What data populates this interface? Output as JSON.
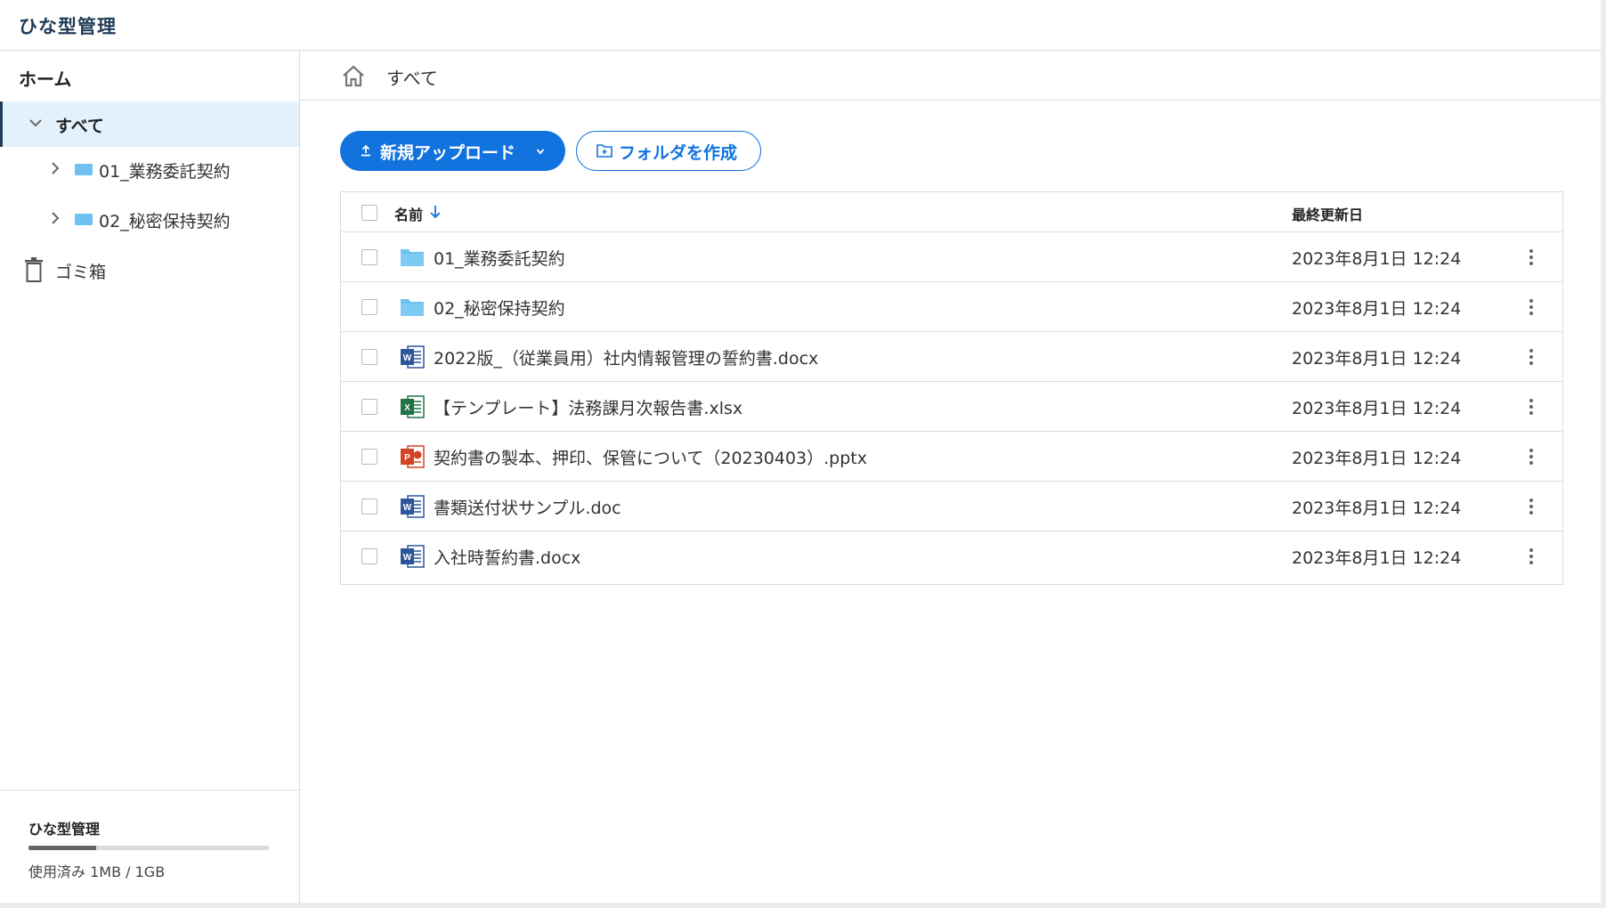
{
  "app": {
    "title": "ひな型管理"
  },
  "sidebar": {
    "home_label": "ホーム",
    "all_label": "すべて",
    "folders": [
      {
        "label": "01_業務委託契約"
      },
      {
        "label": "02_秘密保持契約"
      }
    ],
    "trash_label": "ゴミ箱"
  },
  "usage": {
    "name": "ひな型管理",
    "used_fraction": 0.28,
    "text": "使用済み 1MB /  1GB"
  },
  "breadcrumb": {
    "label": "すべて"
  },
  "toolbar": {
    "upload_label": "新規アップロード",
    "create_folder_label": "フォルダを作成"
  },
  "table": {
    "columns": {
      "name": "名前",
      "updated": "最終更新日"
    },
    "rows": [
      {
        "type": "folder",
        "icon": "folder-icon",
        "name": "01_業務委託契約",
        "updated": "2023年8月1日 12:24"
      },
      {
        "type": "folder",
        "icon": "folder-icon",
        "name": "02_秘密保持契約",
        "updated": "2023年8月1日 12:24"
      },
      {
        "type": "word",
        "icon": "word-file-icon",
        "name": "2022版_（従業員用）社内情報管理の誓約書.docx",
        "updated": "2023年8月1日 12:24"
      },
      {
        "type": "excel",
        "icon": "excel-file-icon",
        "name": "【テンプレート】法務課月次報告書.xlsx",
        "updated": "2023年8月1日 12:24"
      },
      {
        "type": "powerpoint",
        "icon": "powerpoint-file-icon",
        "name": "契約書の製本、押印、保管について（20230403）.pptx",
        "updated": "2023年8月1日 12:24"
      },
      {
        "type": "word",
        "icon": "word-file-icon",
        "name": "書類送付状サンプル.doc",
        "updated": "2023年8月1日 12:24"
      },
      {
        "type": "word",
        "icon": "word-file-icon",
        "name": "入社時誓約書.docx",
        "updated": "2023年8月1日 12:24"
      }
    ]
  },
  "colors": {
    "accent": "#1273de",
    "header_title": "#1f3b57",
    "selected_bg": "#e3f1fc",
    "folder": "#6ec1f0",
    "word": "#2b579a",
    "excel": "#217346",
    "powerpoint": "#d04423"
  }
}
